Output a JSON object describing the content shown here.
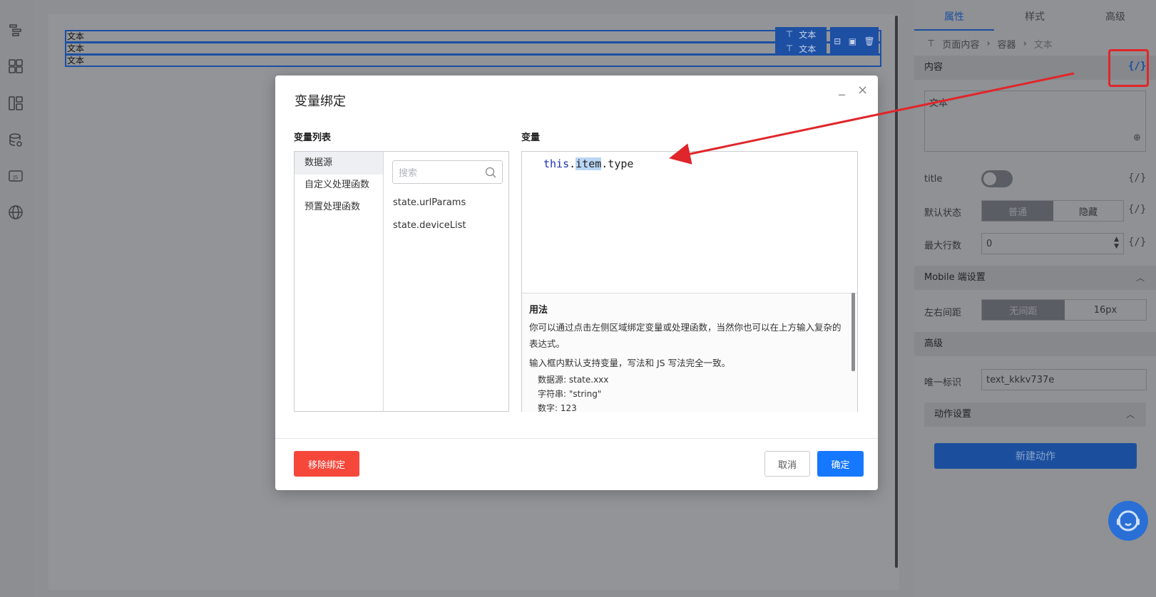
{
  "canvas": {
    "rows": [
      "文本",
      "文本",
      "文本"
    ],
    "toolbar_label": "文本"
  },
  "right_panel": {
    "tabs": [
      "属性",
      "样式",
      "高级"
    ],
    "breadcrumb": [
      "页面内容",
      "容器",
      "文本"
    ],
    "content_section": "内容",
    "content_value": "文本",
    "bind_icon": "{/}",
    "title_label": "title",
    "default_state_label": "默认状态",
    "default_state_options": [
      "普通",
      "隐藏"
    ],
    "max_lines_label": "最大行数",
    "max_lines_value": "0",
    "mobile_section": "Mobile 端设置",
    "padding_label": "左右间距",
    "padding_options": [
      "无间距",
      "16px"
    ],
    "advanced_section": "高级",
    "id_label": "唯一标识",
    "id_value": "text_kkkv737e",
    "action_section": "动作设置",
    "new_action_button": "新建动作"
  },
  "modal": {
    "title": "变量绑定",
    "list_title": "变量列表",
    "var_title": "变量",
    "categories": [
      "数据源",
      "自定义处理函数",
      "预置处理函数"
    ],
    "search_placeholder": "搜索",
    "variables": [
      "state.urlParams",
      "state.deviceList"
    ],
    "code": {
      "kw": "this",
      "dot1": ".",
      "hl": "item",
      "rest": ".type"
    },
    "usage_title": "用法",
    "usage_p1": "你可以通过点击左侧区域绑定变量或处理函数，当然你也可以在上方输入复杂的表达式。",
    "usage_p2": "输入框内默认支持变量，写法和 JS 写法完全一致。",
    "usage_examples": [
      "数据源: state.xxx",
      "字符串: \"string\"",
      "数字: 123"
    ],
    "remove_button": "移除绑定",
    "cancel_button": "取消",
    "confirm_button": "确定",
    "minimize": "_",
    "close": "×"
  },
  "colors": {
    "accent": "#1677ff",
    "danger": "#f5483b",
    "annotation": "#e0262b"
  }
}
